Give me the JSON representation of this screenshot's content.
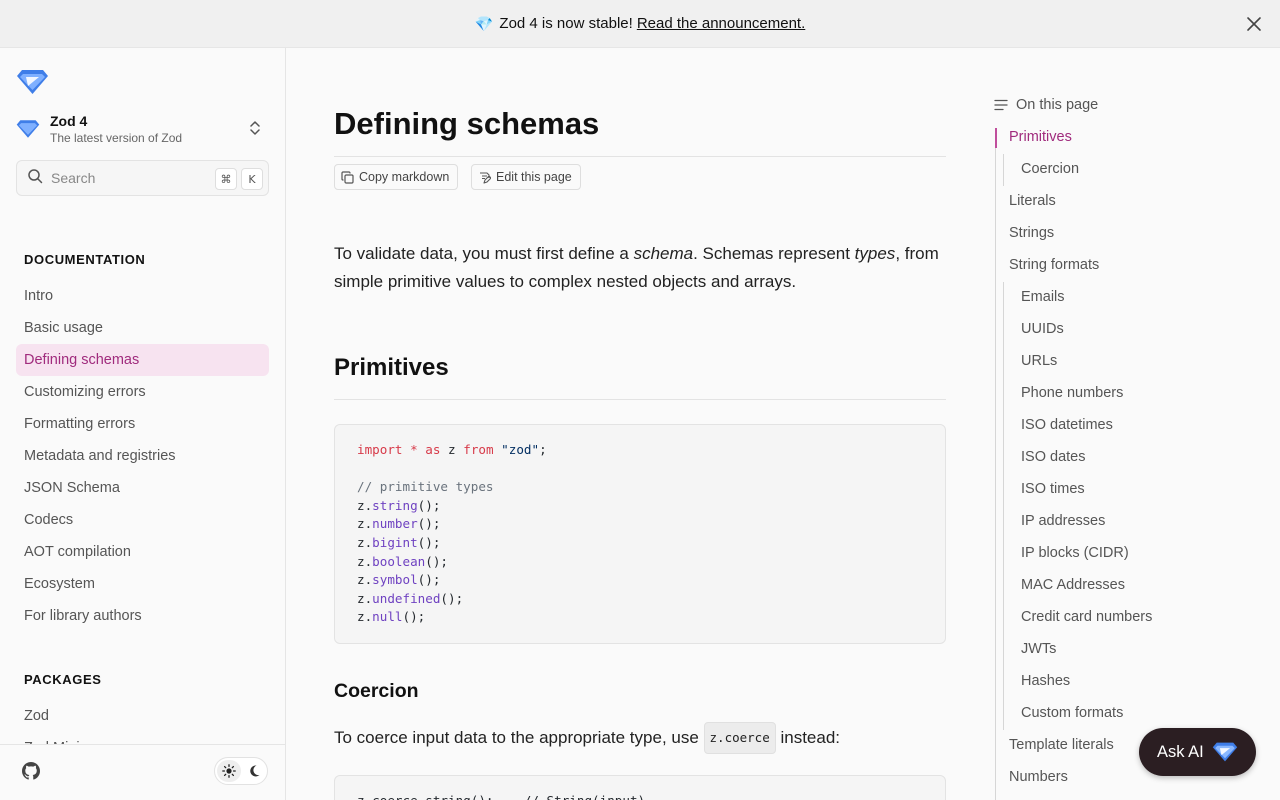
{
  "banner": {
    "emoji": "💎",
    "text": "Zod 4 is now stable!",
    "link": "Read the announcement."
  },
  "sidebar": {
    "version": {
      "title": "Zod 4",
      "subtitle": "The latest version of Zod"
    },
    "search": {
      "placeholder": "Search",
      "shortcut_mod": "⌘",
      "shortcut_key": "K"
    },
    "sections": [
      {
        "title": "DOCUMENTATION",
        "items": [
          {
            "label": "Intro"
          },
          {
            "label": "Basic usage"
          },
          {
            "label": "Defining schemas",
            "active": true
          },
          {
            "label": "Customizing errors"
          },
          {
            "label": "Formatting errors"
          },
          {
            "label": "Metadata and registries"
          },
          {
            "label": "JSON Schema"
          },
          {
            "label": "Codecs"
          },
          {
            "label": "AOT compilation"
          },
          {
            "label": "Ecosystem"
          },
          {
            "label": "For library authors"
          }
        ]
      },
      {
        "title": "PACKAGES",
        "items": [
          {
            "label": "Zod"
          },
          {
            "label": "Zod Mini"
          }
        ]
      }
    ]
  },
  "main": {
    "title": "Defining schemas",
    "buttons": {
      "copy": "Copy markdown",
      "edit": "Edit this page"
    },
    "intro": {
      "p1": "To validate data, you must first define a ",
      "em1": "schema",
      "p2": ". Schemas represent ",
      "em2": "types",
      "p3": ", from simple primitive values to complex nested objects and arrays."
    },
    "h_primitives": "Primitives",
    "code_primitives": {
      "import_kw": "import",
      "import_star": "*",
      "import_as": "as",
      "import_name": "z",
      "import_from": "from",
      "import_mod": "\"zod\"",
      "import_end": ";",
      "comment": "// primitive types",
      "calls": [
        "string",
        "number",
        "bigint",
        "boolean",
        "symbol",
        "undefined",
        "null"
      ],
      "obj": "z.",
      "call_end": "();"
    },
    "h_coercion": "Coercion",
    "coercion_text_before": "To coerce input data to the appropriate type, use ",
    "coercion_code": "z.coerce",
    "coercion_text_after": " instead:",
    "code_coercion_line": "z.coerce.string();    // String(input)"
  },
  "toc": {
    "heading": "On this page",
    "items": [
      {
        "label": "Primitives",
        "level": 1,
        "active": true
      },
      {
        "label": "Coercion",
        "level": 2
      },
      {
        "label": "Literals",
        "level": 1
      },
      {
        "label": "Strings",
        "level": 1
      },
      {
        "label": "String formats",
        "level": 1
      },
      {
        "label": "Emails",
        "level": 2
      },
      {
        "label": "UUIDs",
        "level": 2
      },
      {
        "label": "URLs",
        "level": 2
      },
      {
        "label": "Phone numbers",
        "level": 2
      },
      {
        "label": "ISO datetimes",
        "level": 2
      },
      {
        "label": "ISO dates",
        "level": 2
      },
      {
        "label": "ISO times",
        "level": 2
      },
      {
        "label": "IP addresses",
        "level": 2
      },
      {
        "label": "IP blocks (CIDR)",
        "level": 2
      },
      {
        "label": "MAC Addresses",
        "level": 2
      },
      {
        "label": "Credit card numbers",
        "level": 2
      },
      {
        "label": "JWTs",
        "level": 2
      },
      {
        "label": "Hashes",
        "level": 2
      },
      {
        "label": "Custom formats",
        "level": 2
      },
      {
        "label": "Template literals",
        "level": 1
      },
      {
        "label": "Numbers",
        "level": 1
      }
    ]
  },
  "ask_ai": {
    "label": "Ask AI"
  },
  "colors": {
    "accent": "#a02b7d",
    "active_bg": "#f7e3f0",
    "logo_blue": "#3f7ee8",
    "askai_bg": "#2b1e22"
  },
  "icons": [
    "gem-emoji",
    "close-icon",
    "zod-logo-icon",
    "chevron-updown-icon",
    "search-icon",
    "github-icon",
    "sun-icon",
    "moon-icon",
    "copy-icon",
    "edit-icon",
    "list-icon"
  ]
}
